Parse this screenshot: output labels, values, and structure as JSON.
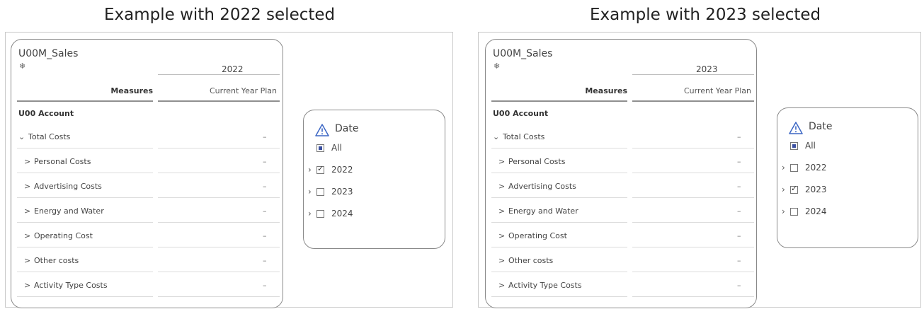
{
  "headings": {
    "left": "Example with 2022 selected",
    "right": "Example with 2023 selected"
  },
  "panels": [
    {
      "table": {
        "model": "U00M_Sales",
        "model_icon": "model-icon",
        "year": "2022",
        "measures_label": "Measures",
        "measure_name": "Current Year Plan",
        "account_label": "U00 Account",
        "rows": [
          {
            "chevron": "⌄",
            "label": "Total Costs",
            "value": "–"
          },
          {
            "chevron": ">",
            "label": "Personal Costs",
            "value": "–"
          },
          {
            "chevron": ">",
            "label": "Advertising Costs",
            "value": "–"
          },
          {
            "chevron": ">",
            "label": "Energy and Water",
            "value": "–"
          },
          {
            "chevron": ">",
            "label": "Operating Cost",
            "value": "–"
          },
          {
            "chevron": ">",
            "label": "Other costs",
            "value": "–"
          },
          {
            "chevron": ">",
            "label": "Activity Type Costs",
            "value": "–"
          }
        ]
      },
      "filter": {
        "title": "Date",
        "icon": "warning-icon",
        "items": [
          {
            "label": "All",
            "state": "partial",
            "expandable": false
          },
          {
            "label": "2022",
            "state": "checked",
            "expandable": true
          },
          {
            "label": "2023",
            "state": "unchecked",
            "expandable": true
          },
          {
            "label": "2024",
            "state": "unchecked",
            "expandable": true
          }
        ]
      }
    },
    {
      "table": {
        "model": "U00M_Sales",
        "model_icon": "model-icon",
        "year": "2023",
        "measures_label": "Measures",
        "measure_name": "Current Year Plan",
        "account_label": "U00 Account",
        "rows": [
          {
            "chevron": "⌄",
            "label": "Total Costs",
            "value": "–"
          },
          {
            "chevron": ">",
            "label": "Personal Costs",
            "value": "–"
          },
          {
            "chevron": ">",
            "label": "Advertising Costs",
            "value": "–"
          },
          {
            "chevron": ">",
            "label": "Energy and Water",
            "value": "–"
          },
          {
            "chevron": ">",
            "label": "Operating Cost",
            "value": "–"
          },
          {
            "chevron": ">",
            "label": "Other costs",
            "value": "–"
          },
          {
            "chevron": ">",
            "label": "Activity Type Costs",
            "value": "–"
          }
        ]
      },
      "filter": {
        "title": "Date",
        "icon": "warning-icon",
        "items": [
          {
            "label": "All",
            "state": "partial",
            "expandable": false
          },
          {
            "label": "2022",
            "state": "unchecked",
            "expandable": true
          },
          {
            "label": "2023",
            "state": "checked",
            "expandable": true
          },
          {
            "label": "2024",
            "state": "unchecked",
            "expandable": true
          }
        ]
      }
    }
  ]
}
